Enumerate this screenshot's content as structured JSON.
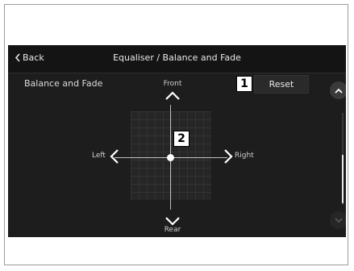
{
  "header": {
    "back_label": "Back",
    "title": "Equaliser / Balance and Fade"
  },
  "section": {
    "label": "Balance and Fade"
  },
  "controls": {
    "reset_label": "Reset"
  },
  "directions": {
    "front": "Front",
    "rear": "Rear",
    "left": "Left",
    "right": "Right"
  },
  "callouts": {
    "one": "1",
    "two": "2"
  },
  "icons": {
    "back": "chevron-left-icon",
    "front": "chevron-up-icon",
    "rear": "chevron-down-icon",
    "left": "chevron-left-icon",
    "right": "chevron-right-icon",
    "scroll_up": "chevron-up-icon",
    "scroll_down": "chevron-down-icon"
  },
  "balance_fade": {
    "balance": 0,
    "fade": 0
  },
  "colors": {
    "screen_bg": "#1d1d1d",
    "header_bg": "#141414",
    "text": "#e8e8e8",
    "grid_line": "#333333"
  }
}
